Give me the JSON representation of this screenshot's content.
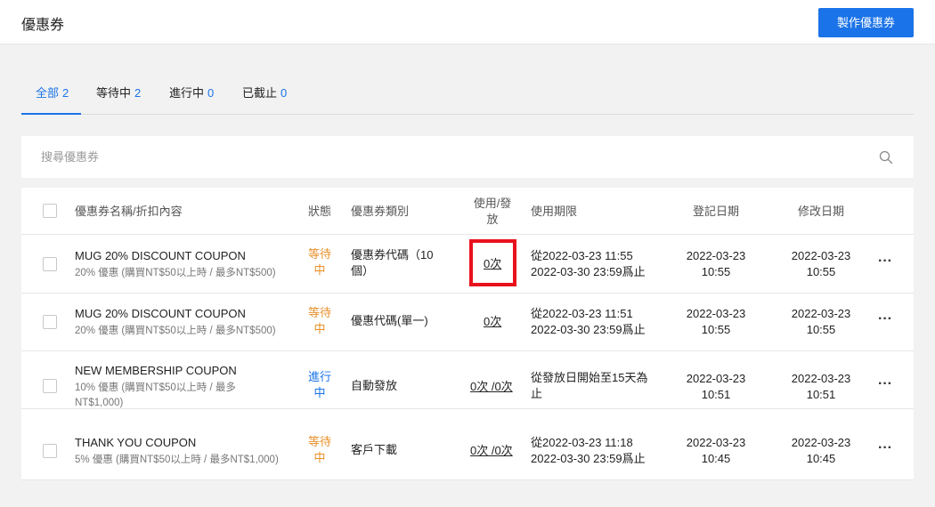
{
  "header": {
    "title": "優惠券",
    "create_button": "製作優惠券"
  },
  "tabs": [
    {
      "label": "全部",
      "count": "2",
      "active": true
    },
    {
      "label": "等待中",
      "count": "2"
    },
    {
      "label": "進行中",
      "count": "0"
    },
    {
      "label": "已截止",
      "count": "0"
    }
  ],
  "search": {
    "placeholder": "搜尋優惠券",
    "icon": "search-icon"
  },
  "table": {
    "columns": {
      "name": "優惠券名稱/折扣內容",
      "status": "狀態",
      "type": "優惠券類別",
      "usage_line1": "使用/發",
      "usage_line2": "放",
      "period": "使用期限",
      "created": "登記日期",
      "modified": "修改日期"
    },
    "rows": [
      {
        "name": "MUG 20% DISCOUNT COUPON",
        "detail": "20% 優惠 (購買NT$50以上時 / 最多NT$500)",
        "status_line1": "等待",
        "status_line2": "中",
        "type_line1": "優惠券代碼（10",
        "type_line2": "個）",
        "usage": "0次",
        "period_line1": "從2022-03-23 11:55",
        "period_line2": "2022-03-30 23:59爲止",
        "created_date": "2022-03-23",
        "created_time": "10:55",
        "modified_date": "2022-03-23",
        "modified_time": "10:55",
        "more": "···"
      },
      {
        "name": "MUG 20% DISCOUNT COUPON",
        "detail": "20% 優惠 (購買NT$50以上時 / 最多NT$500)",
        "status_line1": "等待",
        "status_line2": "中",
        "type_line1": "優惠代碼(單一)",
        "type_line2": "",
        "usage": "0次",
        "period_line1": "從2022-03-23 11:51",
        "period_line2": "2022-03-30 23:59爲止",
        "created_date": "2022-03-23",
        "created_time": "10:55",
        "modified_date": "2022-03-23",
        "modified_time": "10:55",
        "more": "···"
      },
      {
        "name": "NEW MEMBERSHIP COUPON",
        "detail_line1": "10% 優惠 (購買NT$50以上時 / 最多",
        "detail_line2": "NT$1,000)",
        "status_line1": "進行",
        "status_line2": "中",
        "type_line1": "自動發放",
        "type_line2": "",
        "usage": "0次 /0次",
        "period_line1": "從發放日開始至15天為",
        "period_line2": "止",
        "created_date": "2022-03-23",
        "created_time": "10:51",
        "modified_date": "2022-03-23",
        "modified_time": "10:51",
        "more": "···"
      },
      {
        "name": "THANK YOU COUPON",
        "detail": "5% 優惠 (購買NT$50以上時 / 最多NT$1,000)",
        "status_line1": "等待",
        "status_line2": "中",
        "type_line1": "客戶下載",
        "type_line2": "",
        "usage": "0次 /0次",
        "period_line1": "從2022-03-23 11:18",
        "period_line2": "2022-03-30 23:59爲止",
        "created_date": "2022-03-23",
        "created_time": "10:45",
        "modified_date": "2022-03-23",
        "modified_time": "10:45",
        "more": "···"
      }
    ]
  },
  "colors": {
    "accent": "#1a73e8",
    "waiting": "#e8902a",
    "running": "#1a73e8",
    "highlight": "#e8111c"
  }
}
